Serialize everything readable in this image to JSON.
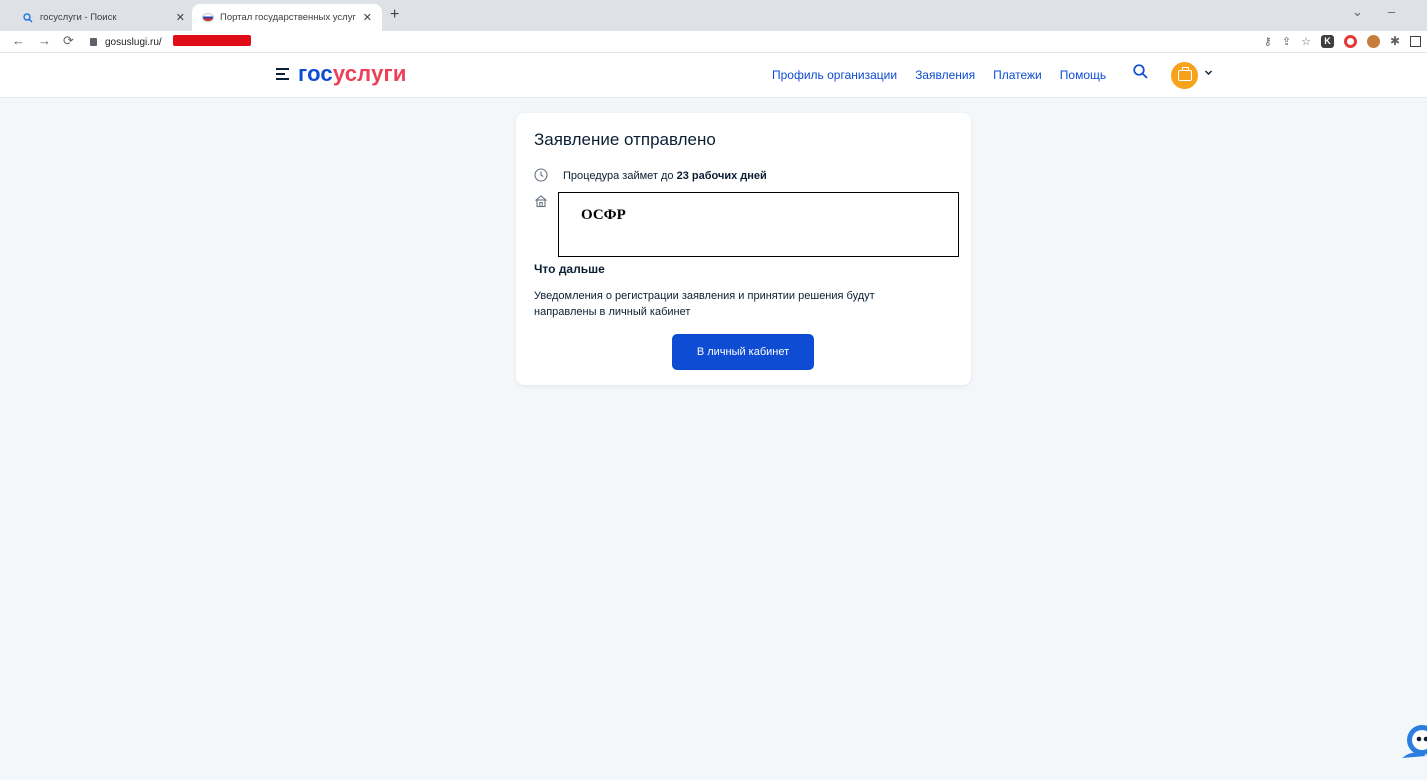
{
  "browser": {
    "tabs": [
      {
        "title": "госуслуги - Поиск",
        "icon": "search-icon",
        "active": false
      },
      {
        "title": "Портал государственных услуг",
        "icon": "flag-icon",
        "active": true
      }
    ],
    "address": "gosuslugi.ru/"
  },
  "header": {
    "logo_gos": "гос",
    "logo_uslugi": "услуги",
    "nav": [
      "Профиль организации",
      "Заявления",
      "Платежи",
      "Помощь"
    ]
  },
  "card": {
    "title": "Заявление отправлено",
    "procedure_prefix": "Процедура займет до ",
    "procedure_bold": "23 рабочих дней",
    "organization": "ОСФР",
    "next_title": "Что дальше",
    "next_text": "Уведомления о регистрации заявления и принятии решения будут направлены в личный кабинет",
    "button_label": "В личный кабинет"
  },
  "colors": {
    "primary": "#0d4cd3",
    "brand_red": "#ee3f58",
    "avatar": "#f7a21b",
    "background": "#f4f7fa"
  }
}
